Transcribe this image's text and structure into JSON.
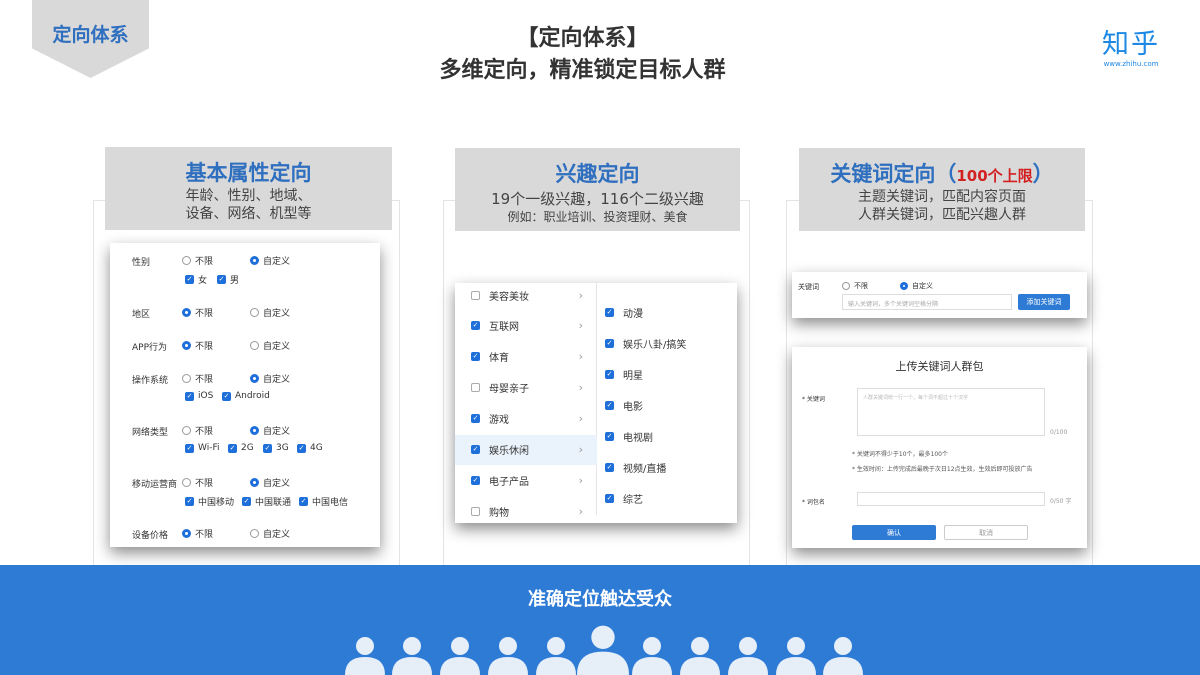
{
  "tag": "定向体系",
  "title_line1": "【定向体系】",
  "title_line2": "多维定向，精准锁定目标人群",
  "logo": {
    "text": "知乎",
    "url": "www.zhihu.com"
  },
  "col1": {
    "title": "基本属性定向",
    "desc1": "年龄、性别、地域、",
    "desc2": "设备、网络、机型等",
    "labels": {
      "gender": "性别",
      "region": "地区",
      "app": "APP行为",
      "os": "操作系统",
      "net": "网络类型",
      "carrier": "移动运营商",
      "price": "设备价格"
    },
    "unlimited": "不限",
    "custom": "自定义",
    "gender_opts": [
      "女",
      "男"
    ],
    "os_opts": [
      "iOS",
      "Android"
    ],
    "net_opts": [
      "Wi-Fi",
      "2G",
      "3G",
      "4G"
    ],
    "carrier_opts": [
      "中国移动",
      "中国联通",
      "中国电信"
    ]
  },
  "col2": {
    "title": "兴趣定向",
    "desc1": "19个一级兴趣，116个二级兴趣",
    "desc2": "例如：职业培训、投资理财、美食",
    "level1": [
      {
        "label": "美容美妆",
        "checked": false
      },
      {
        "label": "互联网",
        "checked": true
      },
      {
        "label": "体育",
        "checked": true
      },
      {
        "label": "母婴亲子",
        "checked": false
      },
      {
        "label": "游戏",
        "checked": true
      },
      {
        "label": "娱乐休闲",
        "checked": true
      },
      {
        "label": "电子产品",
        "checked": true
      },
      {
        "label": "购物",
        "checked": false
      }
    ],
    "level2": [
      "动漫",
      "娱乐八卦/搞笑",
      "明星",
      "电影",
      "电视剧",
      "视频/直播",
      "综艺"
    ]
  },
  "col3": {
    "title": "关键词定向",
    "title_paren_open": "（",
    "title_badge": "100个上限",
    "title_paren_close": "）",
    "desc1": "主题关键词，匹配内容页面",
    "desc2": "人群关键词，匹配兴趣人群",
    "kw_label": "关键词",
    "unlimited": "不限",
    "custom": "自定义",
    "kw_placeholder": "输入关键词，多个关键词空格分隔",
    "add_btn": "添加关键词",
    "upload_title": "上传关键词人群包",
    "kw_field_label": "* 关键词",
    "kw_area_placeholder": "人群关键词统一行一个，每个词不超过十个汉字",
    "kw_count": "0/100",
    "note1": "* 关键词不得少于10个，最多100个",
    "note2": "* 生效时间：上传完成后最晚于次日12点生效，生效后即可投放广告",
    "pkg_label": "* 词包名",
    "pkg_count": "0/50 字",
    "confirm": "确认",
    "cancel": "取消"
  },
  "bottom_text": "准确定位触达受众",
  "colors": {
    "accent": "#2f6fbf",
    "band": "#2e7bd6",
    "check": "#1e6fd9",
    "badge": "#d32020"
  }
}
